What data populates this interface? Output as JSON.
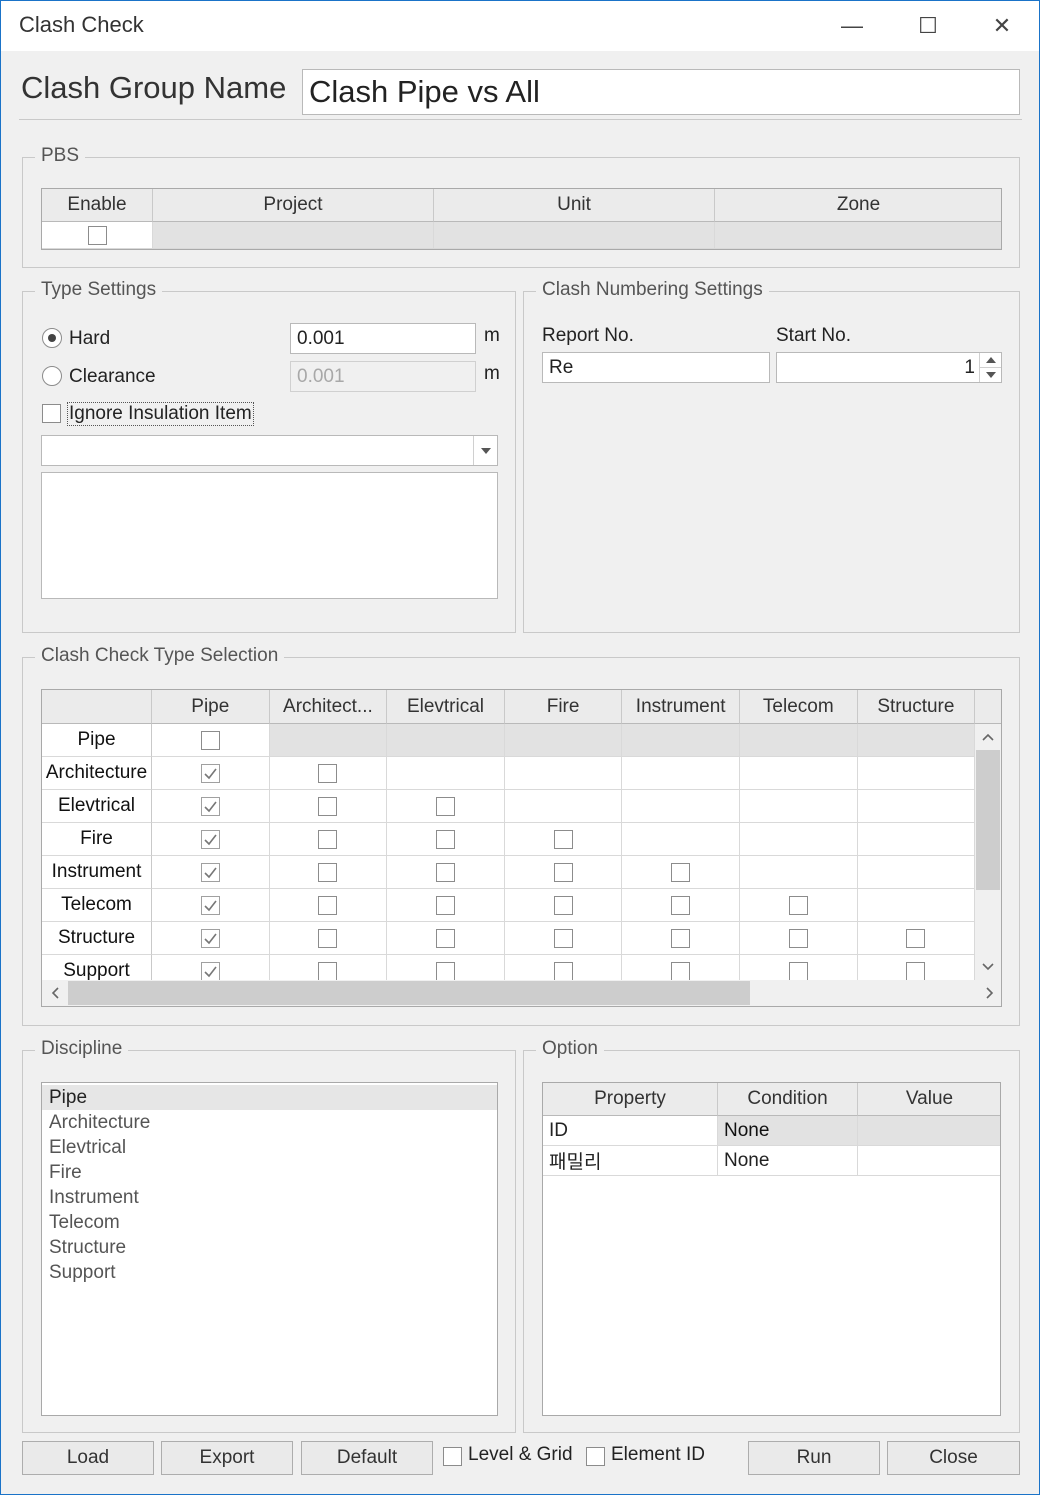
{
  "window": {
    "title": "Clash Check",
    "minimize_glyph": "—",
    "maximize_glyph": "☐",
    "close_glyph": "✕"
  },
  "header": {
    "label": "Clash Group Name",
    "value": "Clash Pipe vs All"
  },
  "pbs": {
    "title": "PBS",
    "columns": [
      "Enable",
      "Project",
      "Unit",
      "Zone"
    ]
  },
  "type_settings": {
    "title": "Type Settings",
    "hard_label": "Hard",
    "hard_value": "0.001",
    "hard_unit": "m",
    "clearance_label": "Clearance",
    "clearance_value": "0.001",
    "clearance_unit": "m",
    "ignore_insulation_label": "Ignore Insulation Item",
    "dropdown_value": ""
  },
  "numbering": {
    "title": "Clash Numbering Settings",
    "report_label": "Report No.",
    "report_value": "Re",
    "start_label": "Start No.",
    "start_value": "1"
  },
  "clash_selection": {
    "title": "Clash Check Type Selection",
    "columns": [
      "Pipe",
      "Architect...",
      "Elevtrical",
      "Fire",
      "Instrument",
      "Telecom",
      "Structure"
    ],
    "rows": [
      "Pipe",
      "Architecture",
      "Elevtrical",
      "Fire",
      "Instrument",
      "Telecom",
      "Structure",
      "Support"
    ],
    "checked_first_column": [
      false,
      true,
      true,
      true,
      true,
      true,
      true,
      true
    ]
  },
  "discipline": {
    "title": "Discipline",
    "items": [
      "Pipe",
      "Architecture",
      "Elevtrical",
      "Fire",
      "Instrument",
      "Telecom",
      "Structure",
      "Support"
    ],
    "selected_index": 0
  },
  "option": {
    "title": "Option",
    "columns": [
      "Property",
      "Condition",
      "Value"
    ],
    "rows": [
      {
        "property": "ID",
        "condition": "None",
        "value": ""
      },
      {
        "property": "패밀리",
        "condition": "None",
        "value": ""
      }
    ]
  },
  "footer": {
    "load": "Load",
    "export": "Export",
    "default": "Default",
    "level_grid": "Level & Grid",
    "element_id": "Element ID",
    "run": "Run",
    "close": "Close"
  }
}
